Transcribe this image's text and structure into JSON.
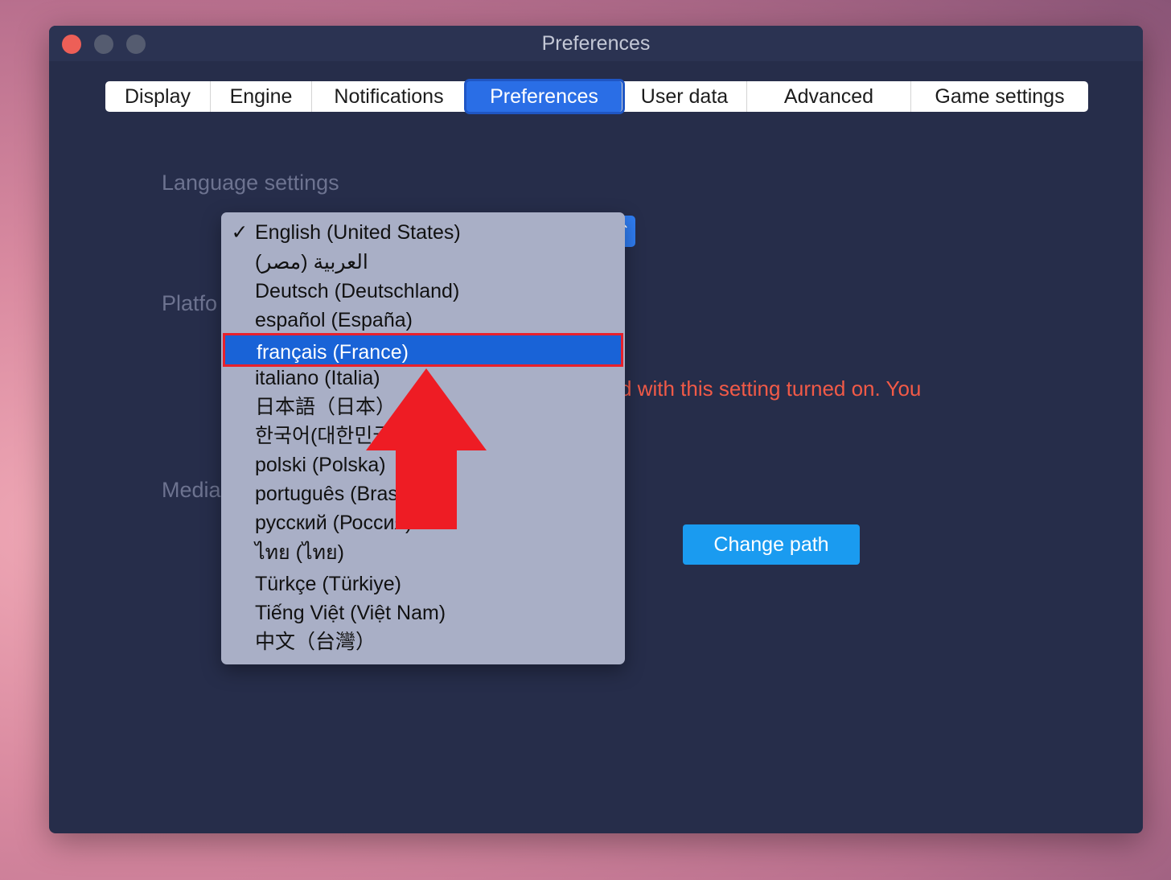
{
  "window": {
    "title": "Preferences"
  },
  "tabs": [
    {
      "label": "Display"
    },
    {
      "label": "Engine"
    },
    {
      "label": "Notifications"
    },
    {
      "label": "Preferences",
      "active": true
    },
    {
      "label": "User data"
    },
    {
      "label": "Advanced"
    },
    {
      "label": "Game settings"
    }
  ],
  "sections": {
    "language": "Language settings",
    "platform": "Platfo",
    "media": "Media"
  },
  "warning_text": "d with this setting turned on. You",
  "change_path_label": "Change path",
  "language_dropdown": {
    "checked_index": 0,
    "highlighted_index": 4,
    "check_mark": "✓",
    "options": [
      "English (United States)",
      "العربية (مصر)",
      "Deutsch (Deutschland)",
      "español (España)",
      "français (France)",
      "italiano (Italia)",
      "日本語（日本）",
      "한국어(대한민국)",
      "polski (Polska)",
      "português (Brasil)",
      "русский (Россия)",
      "ไทย (ไทย)",
      "Türkçe (Türkiye)",
      "Tiếng Việt (Việt Nam)",
      "中文（台灣）"
    ]
  },
  "colors": {
    "accent": "#2a6ee6",
    "highlight": "#1963d7",
    "annotation_red": "#e8212b",
    "window_bg": "#262d4a",
    "warning": "#f25a47"
  }
}
